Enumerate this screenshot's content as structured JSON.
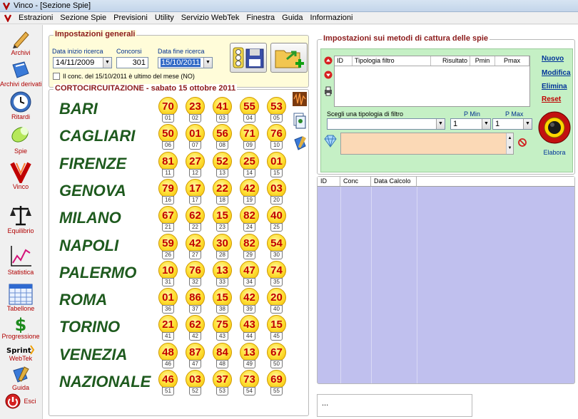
{
  "window": {
    "title": "Vinco - [Sezione Spie]"
  },
  "menu": [
    "Estrazioni",
    "Sezione Spie",
    "Previsioni",
    "Utility",
    "Servizio WebTek",
    "Finestra",
    "Guida",
    "Informazioni"
  ],
  "sidebar": [
    {
      "label": "Archivi",
      "icon": "pencil-icon"
    },
    {
      "label": "Archivi derivati",
      "icon": "book-icon"
    },
    {
      "label": "Ritardi",
      "icon": "clock-icon"
    },
    {
      "label": "Spie",
      "icon": "spotlight-icon"
    },
    {
      "label": "Vinco",
      "icon": "vinco-logo-icon"
    },
    {
      "label": "Equilibrio",
      "icon": "scale-icon"
    },
    {
      "label": "Statistica",
      "icon": "chart-icon"
    },
    {
      "label": "Tabellone",
      "icon": "table-icon"
    },
    {
      "label": "Progressione",
      "icon": "dollar-icon"
    },
    {
      "label": "WebTek",
      "icon": "sprint-logo-icon",
      "brand": "Sprint"
    },
    {
      "label": "Guida",
      "icon": "guide-book-icon"
    },
    {
      "label": "Esci",
      "icon": "exit-icon"
    }
  ],
  "impostazioni_generali": {
    "title": "Impostazioni generali",
    "data_inizio_label": "Data inizio ricerca",
    "data_inizio_value": "14/11/2009",
    "concorsi_label": "Concorsi",
    "concorsi_value": "301",
    "data_fine_label": "Data fine ricerca",
    "data_fine_value": "15/10/2011",
    "checkbox_label": "Il conc. del 15/10/2011 è ultimo del mese (NO)"
  },
  "cortocircuitazione": {
    "title": "CORTOCIRCUITAZIONE - sabato 15 ottobre 2011",
    "ruote": [
      {
        "name": "BARI",
        "numbers": [
          "70",
          "23",
          "41",
          "55",
          "53"
        ],
        "positions": [
          "01",
          "02",
          "03",
          "04",
          "05"
        ]
      },
      {
        "name": "CAGLIARI",
        "numbers": [
          "50",
          "01",
          "56",
          "71",
          "76"
        ],
        "positions": [
          "06",
          "07",
          "08",
          "09",
          "10"
        ]
      },
      {
        "name": "FIRENZE",
        "numbers": [
          "81",
          "27",
          "52",
          "25",
          "01"
        ],
        "positions": [
          "11",
          "12",
          "13",
          "14",
          "15"
        ]
      },
      {
        "name": "GENOVA",
        "numbers": [
          "79",
          "17",
          "22",
          "42",
          "03"
        ],
        "positions": [
          "16",
          "17",
          "18",
          "19",
          "20"
        ]
      },
      {
        "name": "MILANO",
        "numbers": [
          "67",
          "62",
          "15",
          "82",
          "40"
        ],
        "positions": [
          "21",
          "22",
          "23",
          "24",
          "25"
        ]
      },
      {
        "name": "NAPOLI",
        "numbers": [
          "59",
          "42",
          "30",
          "82",
          "54"
        ],
        "positions": [
          "26",
          "27",
          "28",
          "29",
          "30"
        ]
      },
      {
        "name": "PALERMO",
        "numbers": [
          "10",
          "76",
          "13",
          "47",
          "74"
        ],
        "positions": [
          "31",
          "32",
          "33",
          "34",
          "35"
        ]
      },
      {
        "name": "ROMA",
        "numbers": [
          "01",
          "86",
          "15",
          "42",
          "20"
        ],
        "positions": [
          "36",
          "37",
          "38",
          "39",
          "40"
        ]
      },
      {
        "name": "TORINO",
        "numbers": [
          "21",
          "62",
          "75",
          "43",
          "15"
        ],
        "positions": [
          "41",
          "42",
          "43",
          "44",
          "45"
        ]
      },
      {
        "name": "VENEZIA",
        "numbers": [
          "48",
          "87",
          "84",
          "13",
          "67"
        ],
        "positions": [
          "46",
          "47",
          "48",
          "49",
          "50"
        ]
      },
      {
        "name": "NAZIONALE",
        "numbers": [
          "46",
          "03",
          "37",
          "73",
          "69"
        ],
        "positions": [
          "51",
          "52",
          "53",
          "54",
          "55"
        ]
      }
    ]
  },
  "metodi": {
    "title": "Impostazioni sui metodi di cattura delle spie",
    "columns": [
      "ID",
      "Tipologia filtro",
      "Risultato",
      "Pmin",
      "Pmax"
    ],
    "links": [
      "Nuovo",
      "Modifica",
      "Elimina",
      "Reset"
    ],
    "filter_label": "Scegli una tipologia di filtro",
    "filter_value": "",
    "pmin_label": "P Min",
    "pmin_value": "1",
    "pmax_label": "P Max",
    "pmax_value": "1",
    "elabora_label": "Elabora"
  },
  "risultati": {
    "columns": [
      "ID",
      "Conc",
      "Data Calcolo"
    ]
  },
  "status": {
    "text": "..."
  },
  "colors": {
    "city": "#1e5a1e",
    "number": "#c20000",
    "group_title": "#8b1a1a",
    "filter_panel": "#c5f0c5",
    "results_bg": "#c0c0ee",
    "links": "#003399"
  }
}
